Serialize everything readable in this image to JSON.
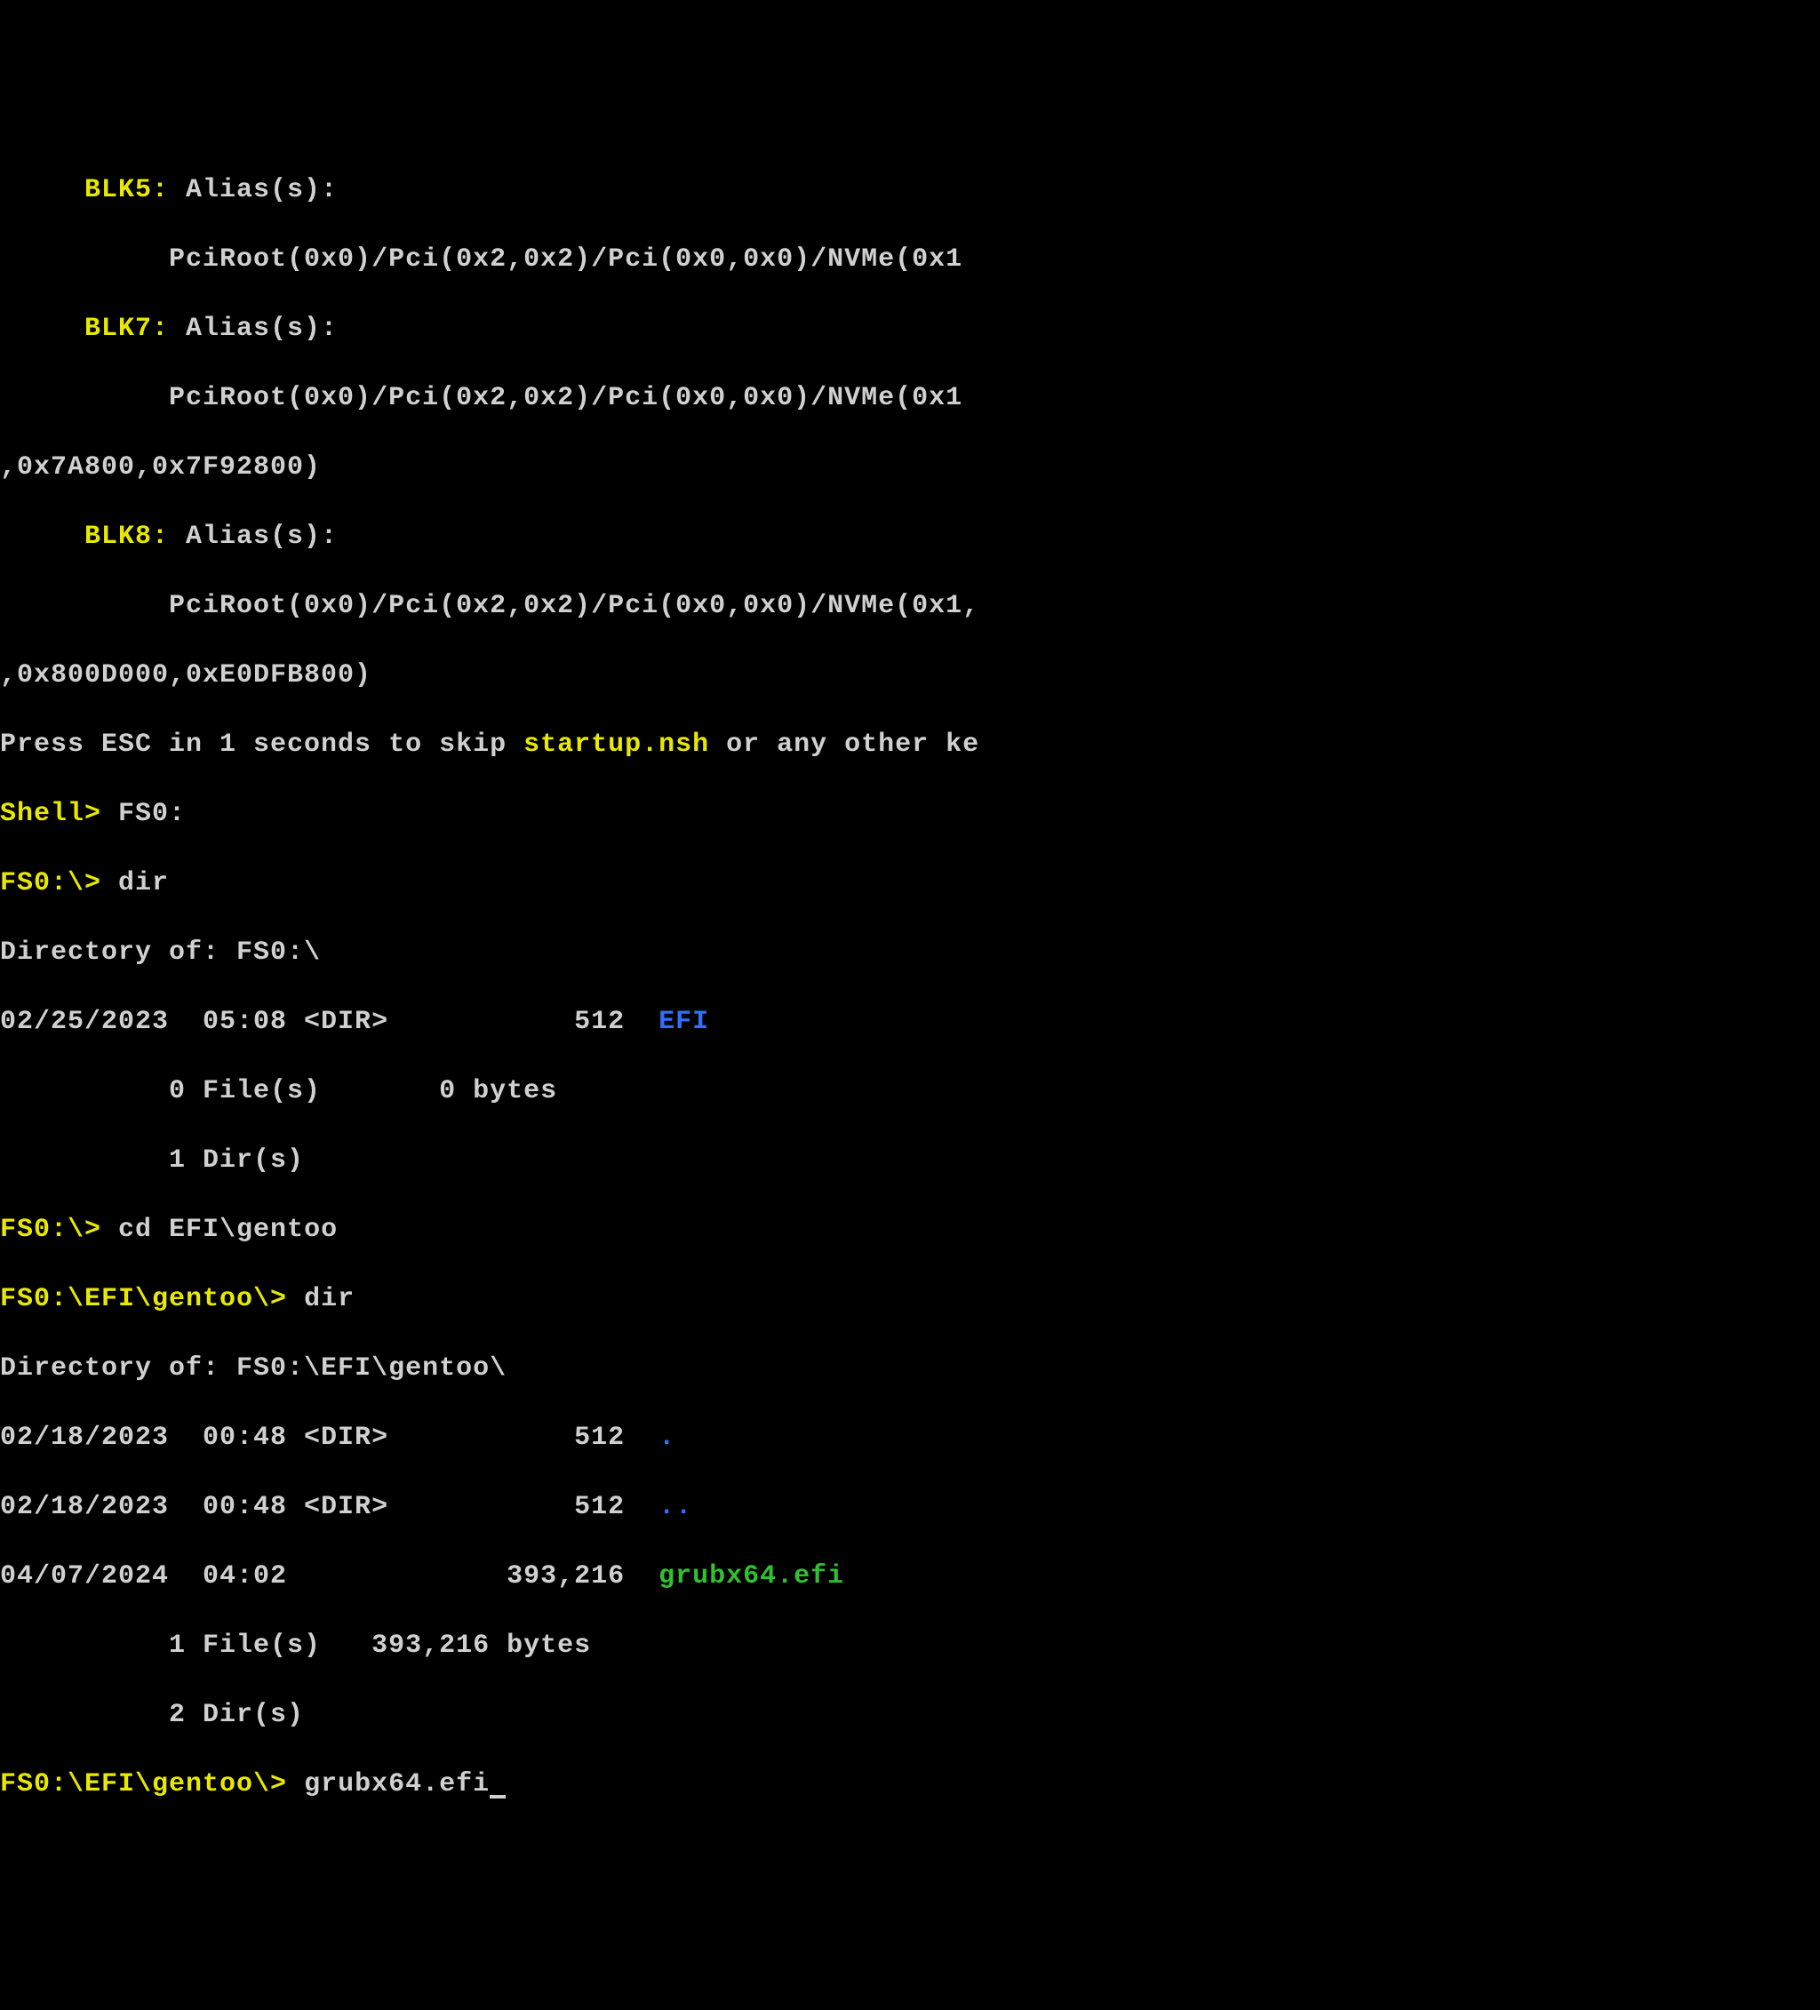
{
  "devmap": {
    "blk5_label": "     BLK5:",
    "blk5_alias": " Alias(s):",
    "blk5_path": "          PciRoot(0x0)/Pci(0x2,0x2)/Pci(0x0,0x0)/NVMe(0x1",
    "blk7_label": "     BLK7:",
    "blk7_alias": " Alias(s):",
    "blk7_path": "          PciRoot(0x0)/Pci(0x2,0x2)/Pci(0x0,0x0)/NVMe(0x1",
    "blk7_cont": ",0x7A800,0x7F92800)",
    "blk8_label": "     BLK8:",
    "blk8_alias": " Alias(s):",
    "blk8_path": "          PciRoot(0x0)/Pci(0x2,0x2)/Pci(0x0,0x0)/NVMe(0x1,",
    "blk8_cont": ",0x800D000,0xE0DFB800)"
  },
  "esc_line": {
    "pre": "Press ESC in 1 seconds to skip ",
    "file": "startup.nsh",
    "post": " or any other ke"
  },
  "shell": {
    "prompt0": "Shell> ",
    "cmd0": "FS0:",
    "prompt1": "FS0:\\> ",
    "cmd1": "dir",
    "dirof1": "Directory of: FS0:\\",
    "row1a": "02/25/2023  05:08 <DIR>           512  ",
    "efi_name": "EFI",
    "row1b": "          0 File(s)       0 bytes",
    "row1c": "          1 Dir(s)",
    "prompt2": "FS0:\\> ",
    "cmd2": "cd EFI\\gentoo",
    "prompt3": "FS0:\\EFI\\gentoo\\> ",
    "cmd3": "dir",
    "dirof2": "Directory of: FS0:\\EFI\\gentoo\\",
    "row2a_pre": "02/18/2023  00:48 <DIR>           512  ",
    "dot": ".",
    "row2b_pre": "02/18/2023  00:48 <DIR>           512  ",
    "dotdot": "..",
    "row2c_pre": "04/07/2024  04:02             393,216  ",
    "grub": "grubx64.efi",
    "row2d": "          1 File(s)   393,216 bytes",
    "row2e": "          2 Dir(s)",
    "prompt4": "FS0:\\EFI\\gentoo\\> ",
    "cmd4": "grubx64.efi"
  }
}
